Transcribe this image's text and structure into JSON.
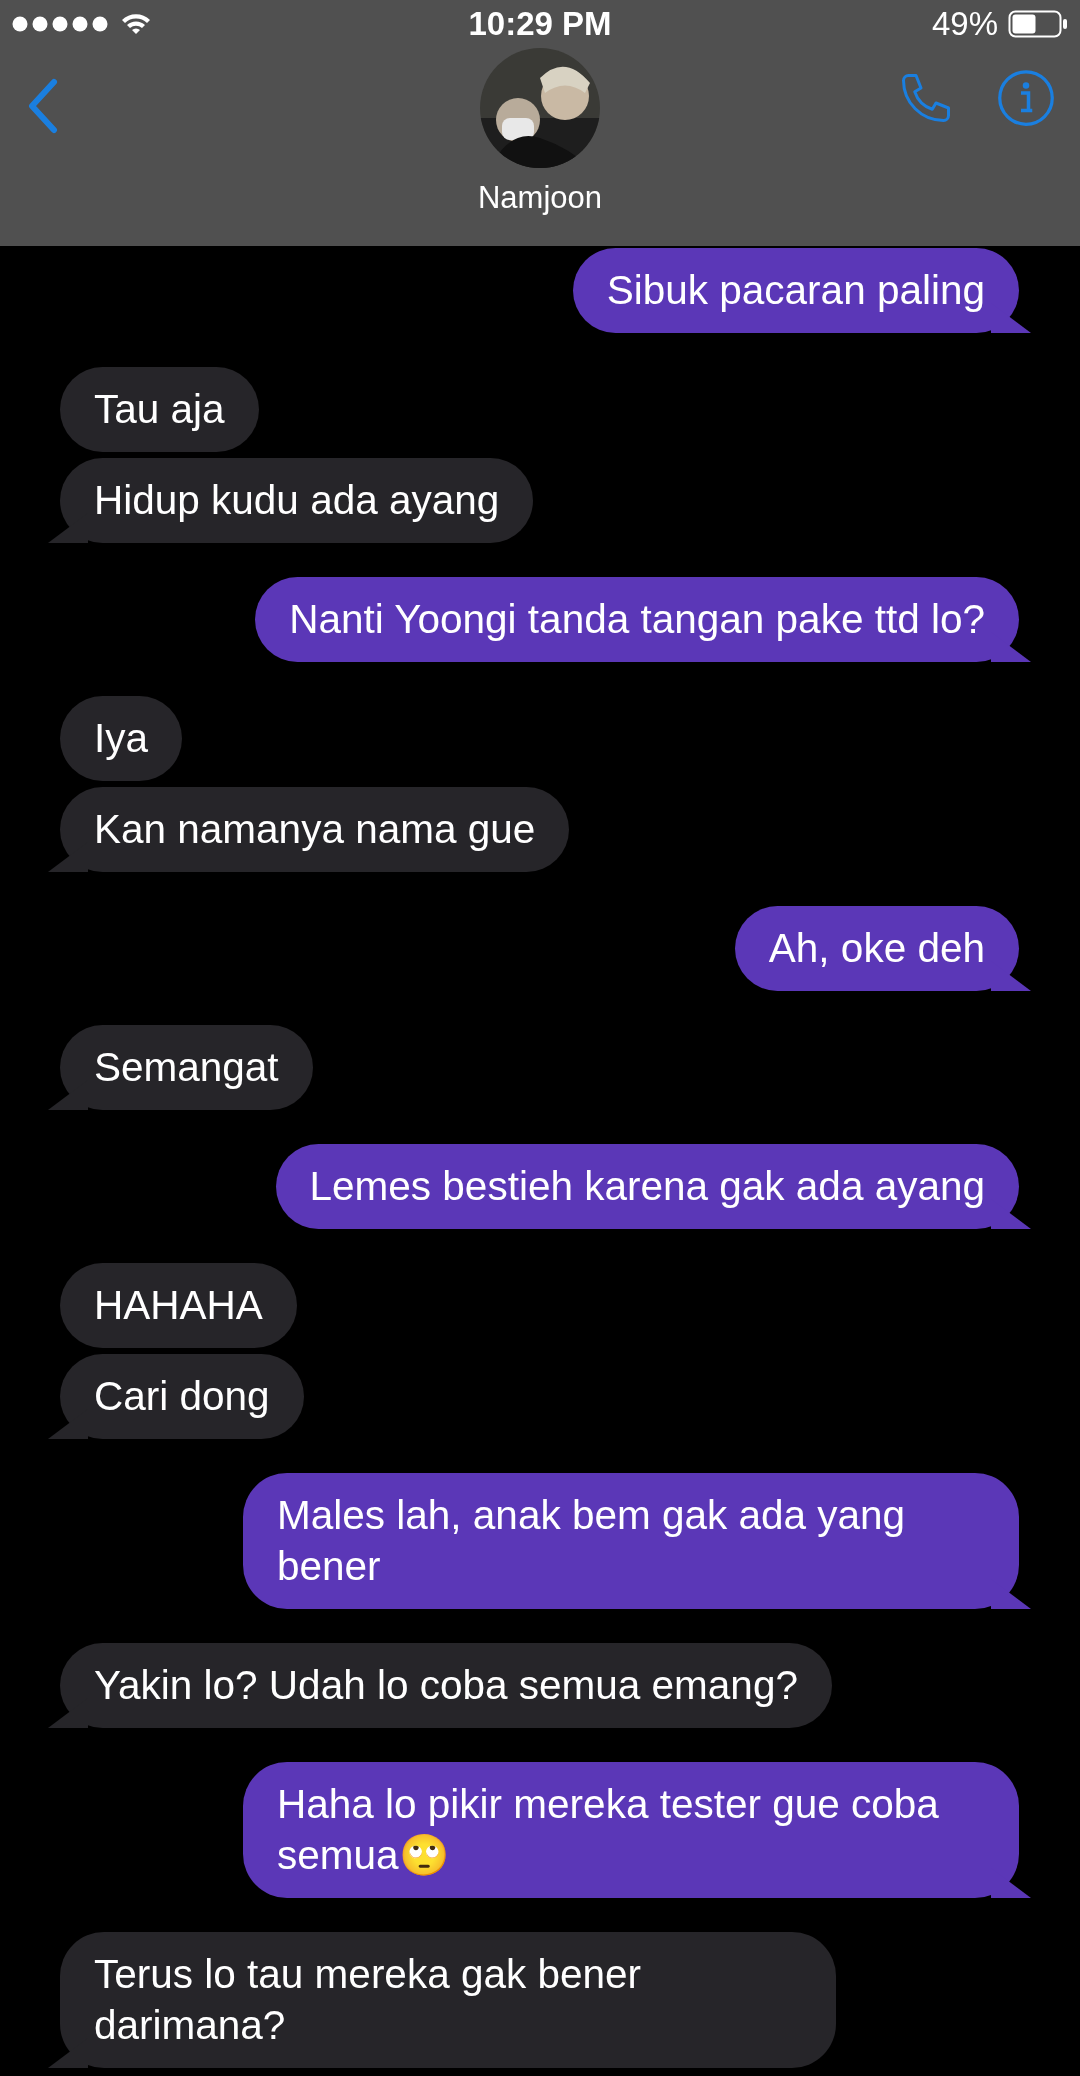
{
  "status_bar": {
    "time": "10:29 PM",
    "battery": "49%"
  },
  "header": {
    "contact_name": "Namjoon"
  },
  "messages": [
    {
      "kind": "sent",
      "text": "Sibuk pacaran paling"
    },
    {
      "kind": "received",
      "text": "Tau aja"
    },
    {
      "kind": "received",
      "text": "Hidup kudu ada ayang"
    },
    {
      "kind": "sent",
      "text": "Nanti Yoongi tanda tangan pake ttd lo?"
    },
    {
      "kind": "received",
      "text": "Iya"
    },
    {
      "kind": "received",
      "text": "Kan namanya nama gue"
    },
    {
      "kind": "sent",
      "text": "Ah, oke deh"
    },
    {
      "kind": "received",
      "text": "Semangat"
    },
    {
      "kind": "sent",
      "text": "Lemes bestieh karena gak ada ayang"
    },
    {
      "kind": "received",
      "text": "HAHAHA"
    },
    {
      "kind": "received",
      "text": "Cari dong"
    },
    {
      "kind": "sent",
      "text": "Males lah, anak bem gak ada yang bener"
    },
    {
      "kind": "received",
      "text": "Yakin lo? Udah lo coba semua emang?"
    },
    {
      "kind": "sent",
      "text": "Haha lo pikir mereka tester gue coba semua🙄"
    },
    {
      "kind": "received",
      "text": "Terus lo tau mereka gak bener darimana?"
    }
  ]
}
